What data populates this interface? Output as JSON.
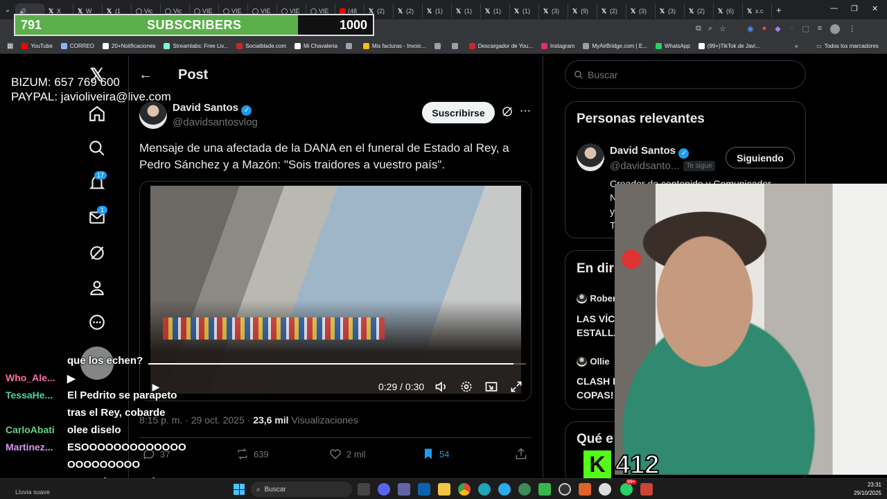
{
  "browser": {
    "tabs": [
      {
        "label": "",
        "icon": "speaker-icon",
        "active": true
      },
      {
        "label": "X",
        "icon": "x-icon"
      },
      {
        "label": "W",
        "icon": "x-icon"
      },
      {
        "label": "(1",
        "icon": "x-icon"
      },
      {
        "label": "Vic",
        "icon": "globe-icon"
      },
      {
        "label": "Vic",
        "icon": "globe-icon"
      },
      {
        "label": "VIE",
        "icon": "globe-icon"
      },
      {
        "label": "VIE",
        "icon": "globe-icon"
      },
      {
        "label": "VIE",
        "icon": "globe-icon"
      },
      {
        "label": "VIE",
        "icon": "globe-icon"
      },
      {
        "label": "VIE",
        "icon": "globe-icon"
      },
      {
        "label": "(48",
        "icon": "youtube-icon"
      },
      {
        "label": "(2)",
        "icon": "x-icon"
      },
      {
        "label": "(2)",
        "icon": "x-icon"
      },
      {
        "label": "(1)",
        "icon": "x-icon"
      },
      {
        "label": "(1)",
        "icon": "x-icon"
      },
      {
        "label": "(1)",
        "icon": "x-icon"
      },
      {
        "label": "(1)",
        "icon": "x-icon"
      },
      {
        "label": "(3)",
        "icon": "x-icon"
      },
      {
        "label": "(9)",
        "icon": "x-icon"
      },
      {
        "label": "(2)",
        "icon": "x-icon"
      },
      {
        "label": "(3)",
        "icon": "x-icon"
      },
      {
        "label": "(3)",
        "icon": "x-icon"
      },
      {
        "label": "(2)",
        "icon": "x-icon"
      },
      {
        "label": "(6)",
        "icon": "x-icon"
      },
      {
        "label": "x.c",
        "icon": "x-icon"
      }
    ],
    "new_tab": "+",
    "bookmarks": [
      {
        "label": "YouTube",
        "color": "#ff0000"
      },
      {
        "label": "CORREO",
        "color": "#8ab4f8"
      },
      {
        "label": "20+Notificaciones",
        "color": "#ffffff"
      },
      {
        "label": "Streamlabs: Free Liv...",
        "color": "#80f5d2"
      },
      {
        "label": "Socialblade.com",
        "color": "#c62828"
      },
      {
        "label": "Mi Chavaleria",
        "color": "#ffffff"
      },
      {
        "label": "",
        "color": "#9aa0a6"
      },
      {
        "label": "Mis facturas - Invoic...",
        "color": "#fbbc04"
      },
      {
        "label": "",
        "color": "#9aa0a6"
      },
      {
        "label": "",
        "color": "#9aa0a6"
      },
      {
        "label": "Descargador de You...",
        "color": "#c62828"
      },
      {
        "label": "Instagram",
        "color": "#e1306c"
      },
      {
        "label": "MyAirBridge.com | E...",
        "color": "#9aa0a6"
      },
      {
        "label": "WhatsApp",
        "color": "#25d366"
      },
      {
        "label": "(99+)TikTok de Javi...",
        "color": "#ffffff"
      }
    ],
    "all_bookmarks": "Todos los marcadores"
  },
  "overlay": {
    "subs_current": "791",
    "subs_label": "SUBSCRIBERS",
    "subs_goal": "1000",
    "subs_progress": 0.791,
    "donate_bizum": "BIZUM: 657 769 600",
    "donate_paypal": "PAYPAL: javioliveira@live.com",
    "viewer_count": "412",
    "kick_logo": "K"
  },
  "nav": {
    "notifications_badge": "17",
    "messages_badge": "1"
  },
  "post": {
    "header": "Post",
    "author_name": "David Santos",
    "author_handle": "@davidsantosvlog",
    "subscribe_label": "Suscribirse",
    "text": "Mensaje de una afectada de la DANA en el funeral de Estado al Rey, a Pedro Sánchez y a Mazón: \"Sois traidores a vuestro país\".",
    "video_time": "0:29 / 0:30",
    "video_progress": 0.967,
    "timestamp": "8:15 p. m. · 29 oct. 2025 ·",
    "views_count": "23,6 mil",
    "views_label": "Visualizaciones",
    "replies": "37",
    "reposts": "639",
    "likes": "2 mil",
    "bookmarks": "54"
  },
  "sidebar": {
    "search_placeholder": "Buscar",
    "relevant_title": "Personas relevantes",
    "rel_name": "David Santos",
    "rel_handle": "@davidsanto...",
    "rel_follows_you": "Te sigue",
    "rel_following": "Siguiendo",
    "rel_bio": "Creador de contenido y Comunicador",
    "rel_bio2": "N",
    "rel_bio3": "y",
    "rel_bio4": "T",
    "live_title": "En dir",
    "live_1_user": "Rober",
    "live_1_title_a": "LAS VÍC",
    "live_1_title_b": "ESTALLA",
    "live_2_user": "Ollie",
    "live_2_title_a": "CLASH I",
    "live_2_title_b": "COPAS!",
    "whats_title": "Qué e"
  },
  "chat": [
    {
      "user": "",
      "msg": "que los echen?",
      "color": "#ffffff"
    },
    {
      "user": "Who_Ale...",
      "msg": "▶",
      "color": "#ff6fa8"
    },
    {
      "user": "TessaHe...",
      "msg": "El Pedrito se parapeto",
      "color": "#4ad6a4"
    },
    {
      "user": "",
      "msg": "tras el Rey, cobarde",
      "color": "#ffffff"
    },
    {
      "user": "CarloAbati",
      "msg": "olee diselo",
      "color": "#5fd38a"
    },
    {
      "user": "Martinez...",
      "msg": "ESOOOOOOOOOOOOO",
      "color": "#d19bf0"
    },
    {
      "user": "",
      "msg": "OOOOOOOOO",
      "color": "#ffffff"
    },
    {
      "user": "akodrako",
      "msg": "uy que buena cadera",
      "color": "#9ec3ff"
    }
  ],
  "taskbar": {
    "weather": "Lluvia suave",
    "search": "Buscar",
    "time": "23:31",
    "date": "29/10/2025",
    "wa_badge": "99+"
  }
}
